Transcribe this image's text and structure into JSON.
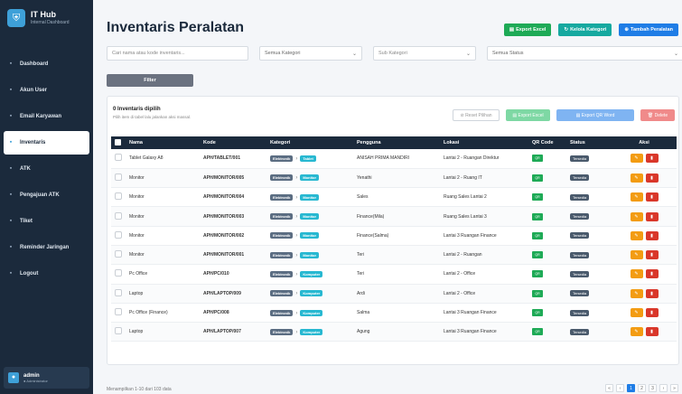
{
  "brand": {
    "title": "IT Hub",
    "subtitle": "Internal Dashboard"
  },
  "sidebar": {
    "items": [
      {
        "label": "Dashboard",
        "icon": "grid-icon"
      },
      {
        "label": "Akun User",
        "icon": "user-icon"
      },
      {
        "label": "Email Karyawan",
        "icon": "mail-icon"
      },
      {
        "label": "Inventaris",
        "icon": "box-icon",
        "active": true
      },
      {
        "label": "ATK",
        "icon": "pencil-icon"
      },
      {
        "label": "Pengajuan ATK",
        "icon": "document-icon"
      },
      {
        "label": "Tiket",
        "icon": "ticket-icon"
      },
      {
        "label": "Reminder Jaringan",
        "icon": "bell-icon"
      },
      {
        "label": "Logout",
        "icon": "logout-icon"
      }
    ]
  },
  "user": {
    "name": "admin",
    "role": "● Administrator"
  },
  "page": {
    "title": "Inventaris Peralatan"
  },
  "top_actions": {
    "export_excel": "Export Excel",
    "kelola_kategori": "Kelola Kategori",
    "tambah": "Tambah Peralatan"
  },
  "filters": {
    "search_placeholder": "Cari nama atau kode inventaris...",
    "kategori": "Semua Kategori",
    "sub_kategori": "Sub Kategori",
    "status": "Semua Status",
    "filter_button": "Filter"
  },
  "selection": {
    "title": "0 Inventaris dipilih",
    "subtitle": "Pilih item di tabel lalu jalankan aksi massal.",
    "reset": "Reset Pilihan",
    "export_excel": "Export Excel",
    "export_qr": "Export QR Word",
    "delete": "Delete"
  },
  "table": {
    "headers": [
      "Nama",
      "Kode",
      "Kategori",
      "Pengguna",
      "Lokasi",
      "QR Code",
      "Status",
      "Aksi"
    ],
    "rows": [
      {
        "nama": "Tablet Galaxy A8",
        "kode": "APH/TABLET/001",
        "kategori": "Elektronik",
        "sub": "Tablet",
        "pengguna": "ANISAH PRIMA MANDIRI",
        "lokasi": "Lantai 2 - Ruangan Direktur",
        "qr": "QR",
        "status": "Tersedia"
      },
      {
        "nama": "Monitor",
        "kode": "APH/MONITOR/005",
        "kategori": "Elektronik",
        "sub": "Monitor",
        "pengguna": "Yenathi",
        "lokasi": "Lantai 2 - Ruang IT",
        "qr": "QR",
        "status": "Tersedia"
      },
      {
        "nama": "Monitor",
        "kode": "APH/MONITOR/004",
        "kategori": "Elektronik",
        "sub": "Monitor",
        "pengguna": "Sales",
        "lokasi": "Ruang Sales Lantai 2",
        "qr": "QR",
        "status": "Tersedia"
      },
      {
        "nama": "Monitor",
        "kode": "APH/MONITOR/003",
        "kategori": "Elektronik",
        "sub": "Monitor",
        "pengguna": "Finance(Mila)",
        "lokasi": "Ruang Sales Lantai 3",
        "qr": "QR",
        "status": "Tersedia"
      },
      {
        "nama": "Monitor",
        "kode": "APH/MONITOR/002",
        "kategori": "Elektronik",
        "sub": "Monitor",
        "pengguna": "Finance(Salma)",
        "lokasi": "Lantai 3 Ruangan Finance",
        "qr": "QR",
        "status": "Tersedia"
      },
      {
        "nama": "Monitor",
        "kode": "APH/MONITOR/001",
        "kategori": "Elektronik",
        "sub": "Monitor",
        "pengguna": "Teri",
        "lokasi": "Lantai 2 - Ruangan",
        "qr": "QR",
        "status": "Tersedia"
      },
      {
        "nama": "Pc Office",
        "kode": "APH/PC/010",
        "kategori": "Elektronik",
        "sub": "Komputer",
        "pengguna": "Teri",
        "lokasi": "Lantai 2 - Office",
        "qr": "QR",
        "status": "Tersedia"
      },
      {
        "nama": "Laptop",
        "kode": "APH/LAPTOP/009",
        "kategori": "Elektronik",
        "sub": "Komputer",
        "pengguna": "Ardi",
        "lokasi": "Lantai 2 - Office",
        "qr": "QR",
        "status": "Tersedia"
      },
      {
        "nama": "Pc Office (Finance)",
        "kode": "APH/PC/008",
        "kategori": "Elektronik",
        "sub": "Komputer",
        "pengguna": "Salma",
        "lokasi": "Lantai 3 Ruangan Finance",
        "qr": "QR",
        "status": "Tersedia"
      },
      {
        "nama": "Laptop",
        "kode": "APH/LAPTOP/007",
        "kategori": "Elektronik",
        "sub": "Komputer",
        "pengguna": "Agung",
        "lokasi": "Lantai 3 Ruangan Finance",
        "qr": "QR",
        "status": "Tersedia"
      }
    ]
  },
  "footer": {
    "info": "Menampilkan 1-10 dari 103 data"
  },
  "pagination": [
    "«",
    "‹",
    "1",
    "2",
    "3",
    "›",
    "»"
  ],
  "colors": {
    "sidebar": "#1b2a3c",
    "accent": "#1f7de6",
    "success": "#1eaa56",
    "danger": "#d9372a",
    "warning": "#f39c12"
  }
}
